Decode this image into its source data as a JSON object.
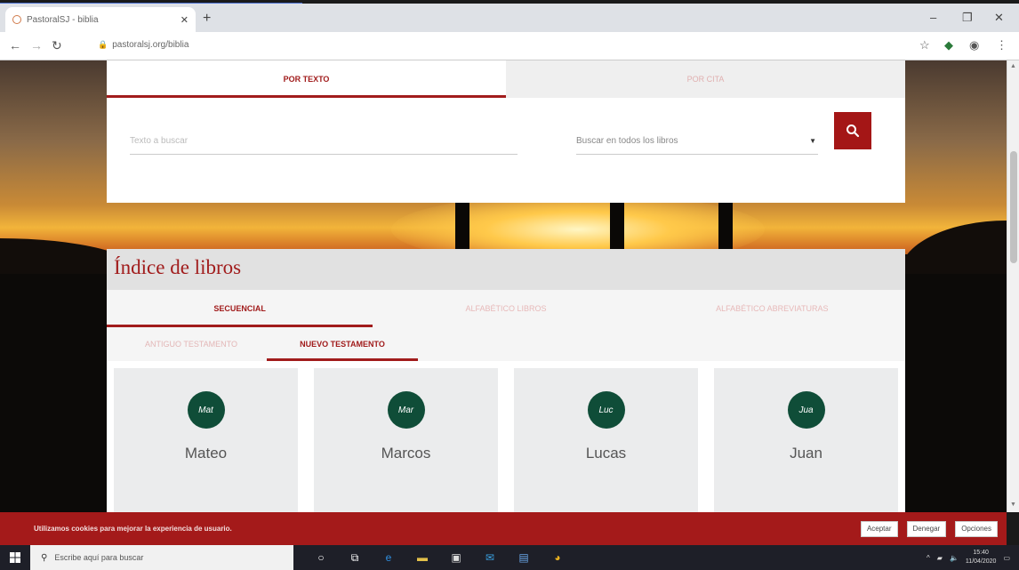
{
  "browser": {
    "tab_title": "PastoralSJ - biblia",
    "url": "pastoralsj.org/biblia"
  },
  "search": {
    "tabs": [
      "POR TEXTO",
      "POR CITA"
    ],
    "placeholder": "Texto a buscar",
    "scope_selected": "Buscar en todos los libros"
  },
  "index": {
    "title": "Índice de libros",
    "order_tabs": [
      "SECUENCIAL",
      "ALFABÉTICO LIBROS",
      "ALFABÉTICO ABREVIATURAS"
    ],
    "testament_tabs": [
      "ANTIGUO TESTAMENTO",
      "NUEVO TESTAMENTO"
    ],
    "books": [
      {
        "abbr": "Mat",
        "name": "Mateo"
      },
      {
        "abbr": "Mar",
        "name": "Marcos"
      },
      {
        "abbr": "Luc",
        "name": "Lucas"
      },
      {
        "abbr": "Jua",
        "name": "Juan"
      }
    ]
  },
  "cookies": {
    "message": "Utilizamos cookies para mejorar la experiencia de usuario.",
    "accept": "Aceptar",
    "deny": "Denegar",
    "options": "Opciones"
  },
  "taskbar": {
    "search_placeholder": "Escribe aquí para buscar",
    "time": "15:40",
    "date": "11/04/2020"
  },
  "colors": {
    "brand_red": "#a41616",
    "badge_green": "#0f4d38"
  }
}
